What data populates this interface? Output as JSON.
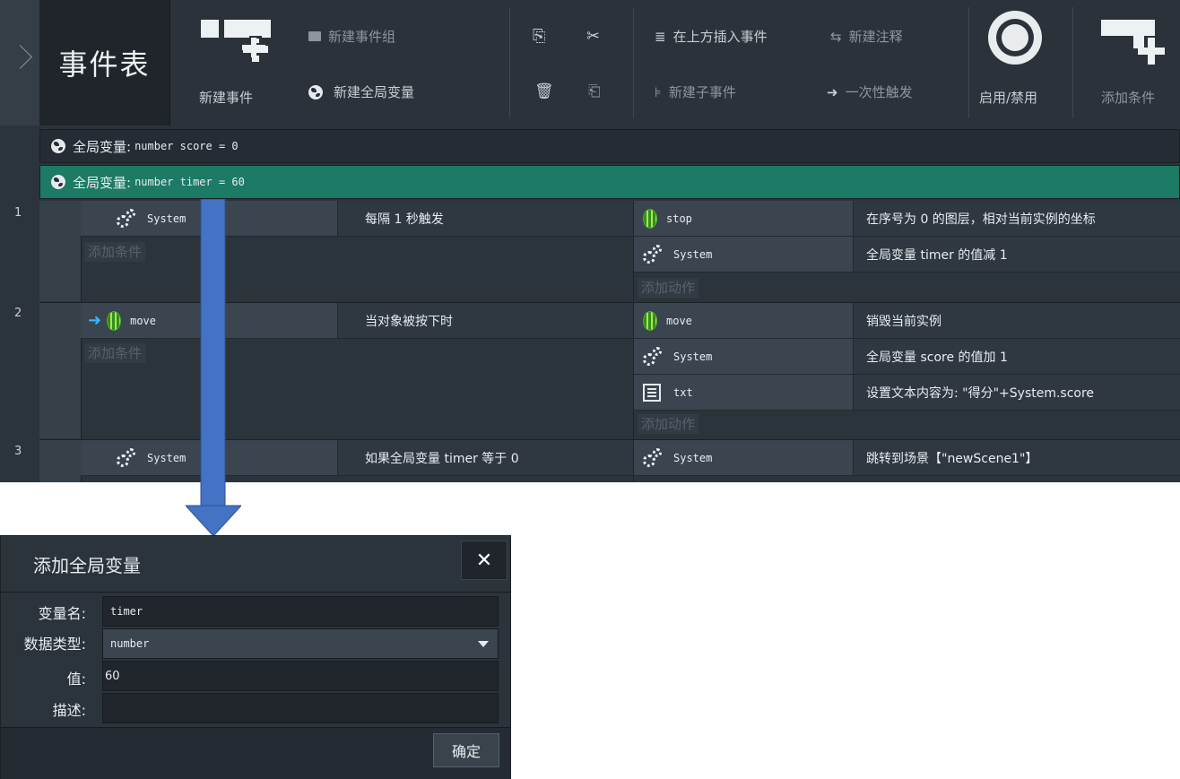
{
  "toolbar": {
    "title": "事件表",
    "new_event": "新建事件",
    "new_event_group": "新建事件组",
    "new_global_var": "新建全局变量",
    "insert_above": "在上方插入事件",
    "new_comment": "新建注释",
    "new_sub_event": "新建子事件",
    "trigger_once": "一次性触发",
    "enable_disable": "启用/禁用",
    "add_condition": "添加条件"
  },
  "globals": [
    {
      "label": "全局变量:",
      "decl": "number  score = 0",
      "selected": false
    },
    {
      "label": "全局变量:",
      "decl": "number  timer = 60",
      "selected": true
    }
  ],
  "events": [
    {
      "num": "1",
      "conditions": [
        {
          "object": "System",
          "icon": "gear-icon",
          "text": "每隔 1 秒触发"
        }
      ],
      "add_condition": "添加条件",
      "actions": [
        {
          "object": "stop",
          "icon": "melon-icon",
          "text": "在序号为 0 的图层，相对当前实例的坐标"
        },
        {
          "object": "System",
          "icon": "gear-icon",
          "text": "全局变量 timer 的值减 1"
        }
      ],
      "add_action": "添加动作"
    },
    {
      "num": "2",
      "conditions": [
        {
          "object": "move",
          "icon": "melon-icon",
          "text": "当对象被按下时"
        }
      ],
      "add_condition": "添加条件",
      "actions": [
        {
          "object": "move",
          "icon": "melon-icon",
          "text": "销毁当前实例"
        },
        {
          "object": "System",
          "icon": "gear-icon",
          "text": "全局变量 score 的值加 1"
        },
        {
          "object": "txt",
          "icon": "text-object-icon",
          "text": "设置文本内容为: \"得分\"+System.score"
        }
      ],
      "add_action": "添加动作"
    },
    {
      "num": "3",
      "conditions": [
        {
          "object": "System",
          "icon": "gear-icon",
          "text": "如果全局变量 timer 等于 0"
        }
      ],
      "actions": [
        {
          "object": "System",
          "icon": "gear-icon",
          "text": "跳转到场景【\"newScene1\"】"
        }
      ]
    }
  ],
  "dialog": {
    "title": "添加全局变量",
    "name_label": "变量名:",
    "name_value": "timer",
    "type_label": "数据类型:",
    "type_value": "number",
    "value_label": "值:",
    "value_value": "60",
    "desc_label": "描述:",
    "desc_value": "",
    "ok": "确定"
  },
  "colors": {
    "selected_row": "#1d7a65",
    "arrow": "#4472c4",
    "panel": "#2c343b"
  }
}
